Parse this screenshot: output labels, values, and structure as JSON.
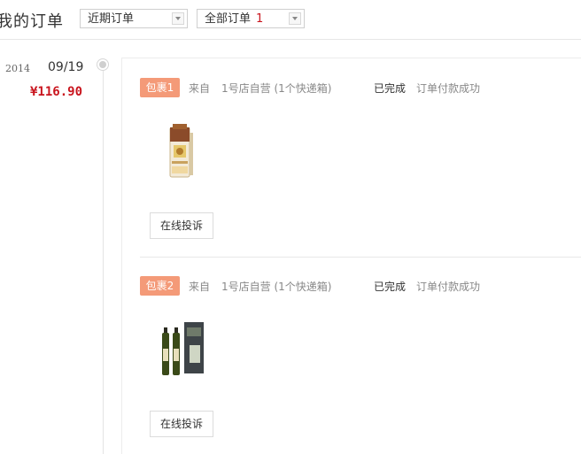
{
  "header": {
    "title": "我的订单",
    "recent_select": "近期订单",
    "all_select": "全部订单",
    "all_count": "1"
  },
  "order": {
    "year": "2014",
    "date": "09/19",
    "amount": "¥116.90",
    "packages": [
      {
        "badge": "包裹1",
        "from_label": "来自",
        "shop": "1号店自营 (1个快递箱)",
        "status": "已完成",
        "payment": "订单付款成功",
        "complain_label": "在线投诉",
        "product_icon": "snack-box-product"
      },
      {
        "badge": "包裹2",
        "from_label": "来自",
        "shop": "1号店自营 (1个快递箱)",
        "status": "已完成",
        "payment": "订单付款成功",
        "complain_label": "在线投诉",
        "product_icon": "olive-oil-gift-set-product"
      }
    ]
  },
  "colors": {
    "accent_red": "#c9151e",
    "badge_orange": "#f49a78"
  }
}
